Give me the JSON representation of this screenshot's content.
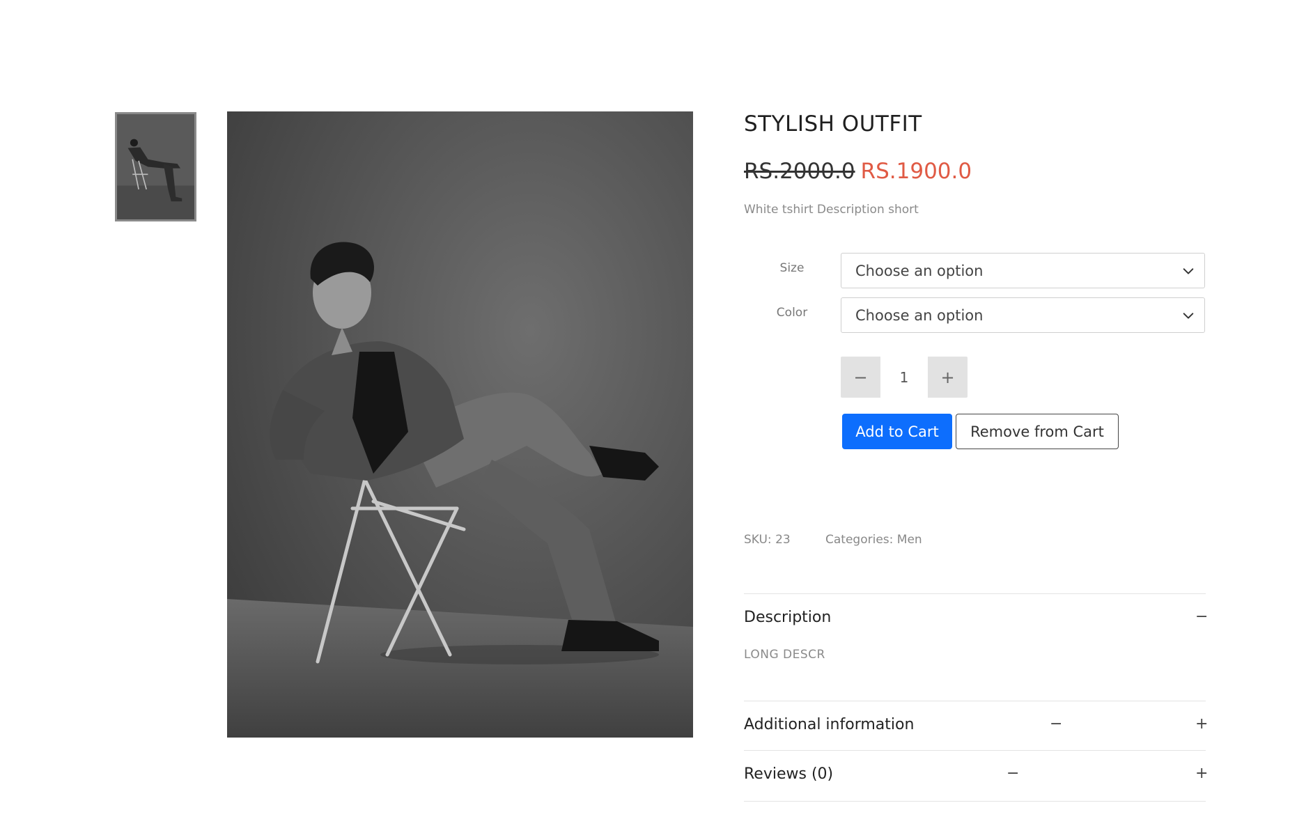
{
  "gallery": {
    "thumbnail_alt": "product thumbnail",
    "main_image_alt": "man in denim jacket seated on folding chair"
  },
  "product": {
    "title": "STYLISH OUTFIT",
    "price_old": "RS.2000.0",
    "price_new": "RS.1900.0",
    "short_description": "White tshirt Description short"
  },
  "options": {
    "size_label": "Size",
    "size_value": "Choose an option",
    "color_label": "Color",
    "color_value": "Choose an option"
  },
  "quantity": {
    "minus": "−",
    "value": "1",
    "plus": "+"
  },
  "buttons": {
    "add_to_cart": "Add to Cart",
    "remove_from_cart": "Remove from Cart"
  },
  "meta": {
    "sku_label": "SKU:",
    "sku_value": "23",
    "categories_label": "Categories:",
    "categories_value": "Men"
  },
  "accordion": {
    "description_title": "Description",
    "description_icon": "−",
    "description_body": "LONG DESCR",
    "additional_title": "Additional information",
    "additional_minus": "−",
    "additional_plus": "+",
    "reviews_title": "Reviews (0)",
    "reviews_minus": "−",
    "reviews_plus": "+"
  },
  "colors": {
    "accent": "#0d6efd",
    "sale_price": "#e05a44"
  }
}
